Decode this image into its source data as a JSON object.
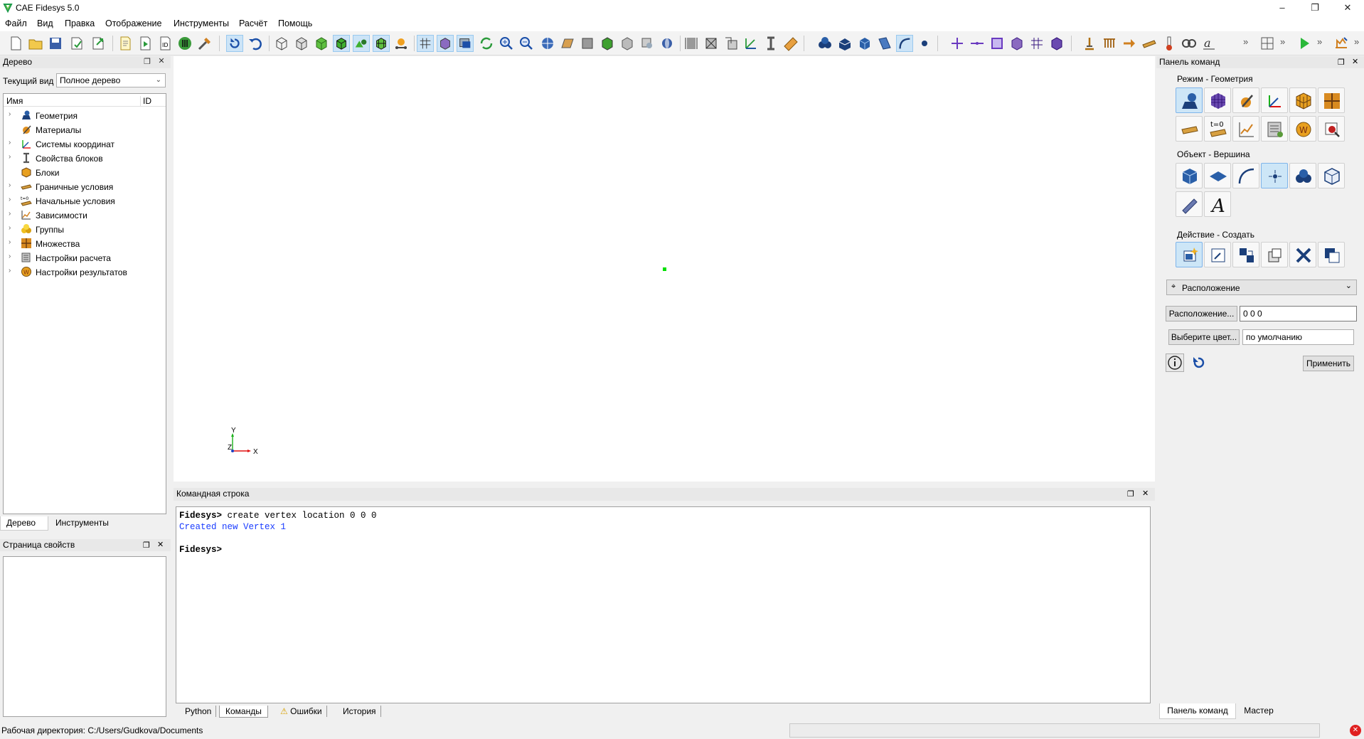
{
  "window": {
    "title": "CAE Fidesys 5.0",
    "minimize_icon": "minimize-icon",
    "restore_icon": "restore-icon",
    "close_icon": "close-icon"
  },
  "menu": {
    "items": [
      "Файл",
      "Вид",
      "Правка",
      "Отображение",
      "Инструменты",
      "Расчёт",
      "Помощь"
    ]
  },
  "tree_panel": {
    "title": "Дерево",
    "current_view_label": "Текущий вид",
    "current_view_value": "Полное дерево",
    "col_name": "Имя",
    "col_id": "ID",
    "items": [
      {
        "label": "Геометрия",
        "icon": "geometry-icon",
        "expandable": true
      },
      {
        "label": "Материалы",
        "icon": "materials-icon",
        "expandable": false
      },
      {
        "label": "Системы координат",
        "icon": "coordinate-systems-icon",
        "expandable": true
      },
      {
        "label": "Свойства блоков",
        "icon": "block-properties-icon",
        "expandable": true
      },
      {
        "label": "Блоки",
        "icon": "blocks-icon",
        "expandable": false
      },
      {
        "label": "Граничные условия",
        "icon": "boundary-conditions-icon",
        "expandable": true
      },
      {
        "label": "Начальные условия",
        "icon": "initial-conditions-icon",
        "expandable": true
      },
      {
        "label": "Зависимости",
        "icon": "dependencies-icon",
        "expandable": true
      },
      {
        "label": "Группы",
        "icon": "groups-icon",
        "expandable": true
      },
      {
        "label": "Множества",
        "icon": "sets-icon",
        "expandable": true
      },
      {
        "label": "Настройки расчета",
        "icon": "analysis-settings-icon",
        "expandable": true
      },
      {
        "label": "Настройки результатов",
        "icon": "results-settings-icon",
        "expandable": true
      }
    ],
    "tabs": [
      "Дерево",
      "Инструменты"
    ]
  },
  "properties_panel": {
    "title": "Страница свойств"
  },
  "viewport": {
    "axis_x": "X",
    "axis_y": "Y",
    "axis_z": "Z",
    "vertex_color": "#00e000"
  },
  "command_line": {
    "title": "Командная строка",
    "lines": [
      {
        "prompt": "Fidesys>",
        "text": " create vertex location 0 0 0",
        "type": "input"
      },
      {
        "prompt": "",
        "text": "Created new Vertex 1",
        "type": "output"
      },
      {
        "prompt": "",
        "text": "",
        "type": "blank"
      },
      {
        "prompt": "Fidesys>",
        "text": "",
        "type": "input"
      }
    ],
    "tabs": [
      "Python",
      "Команды",
      "Ошибки",
      "История"
    ],
    "output_color": "#1a3cff"
  },
  "command_panel": {
    "title": "Панель команд",
    "mode_label": "Режим - Геометрия",
    "object_label": "Объект - Вершина",
    "action_label": "Действие - Создать",
    "method_value": "Расположение",
    "location_button": "Расположение...",
    "location_value": "0 0 0",
    "color_button": "Выберите цвет...",
    "color_value": "по умолчанию",
    "apply_button": "Применить",
    "bottom_tabs": [
      "Панель команд",
      "Мастер"
    ]
  },
  "status": {
    "working_dir": "Рабочая директория: C:/Users/Gudkova/Documents"
  },
  "colors": {
    "accent": "#0078d7",
    "selected_bg": "#cde6f7"
  }
}
